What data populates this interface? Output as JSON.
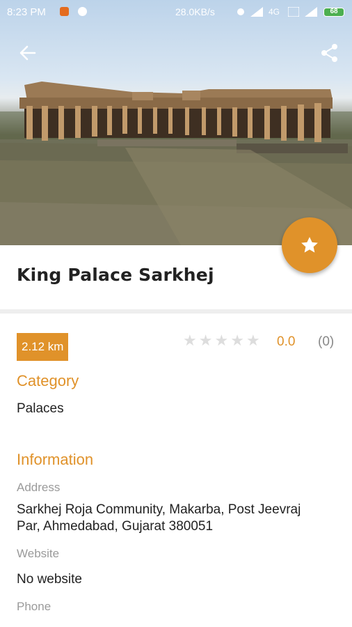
{
  "status_bar": {
    "time": "8:23 PM",
    "net_speed": "28.0KB/s",
    "network": "4G",
    "battery": "68"
  },
  "toolbar": {
    "back_icon": "arrow-back-icon",
    "share_icon": "share-icon"
  },
  "place": {
    "name": "King Palace Sarkhej",
    "distance": "2.12 km",
    "rating_value": "0.0",
    "rating_count": "(0)",
    "stars_total": 5,
    "stars_filled": 0
  },
  "category": {
    "heading": "Category",
    "value": "Palaces"
  },
  "information": {
    "heading": "Information",
    "address_label": "Address",
    "address_line1": "Sarkhej Roja Community, Makarba, Post Jeevraj",
    "address_line2": "Par, Ahmedabad, Gujarat 380051",
    "website_label": "Website",
    "website_value": "No website",
    "phone_label": "Phone"
  },
  "colors": {
    "accent": "#e0922a",
    "text": "#222222",
    "muted": "#9a9a9a",
    "star_empty": "#dddddd"
  }
}
